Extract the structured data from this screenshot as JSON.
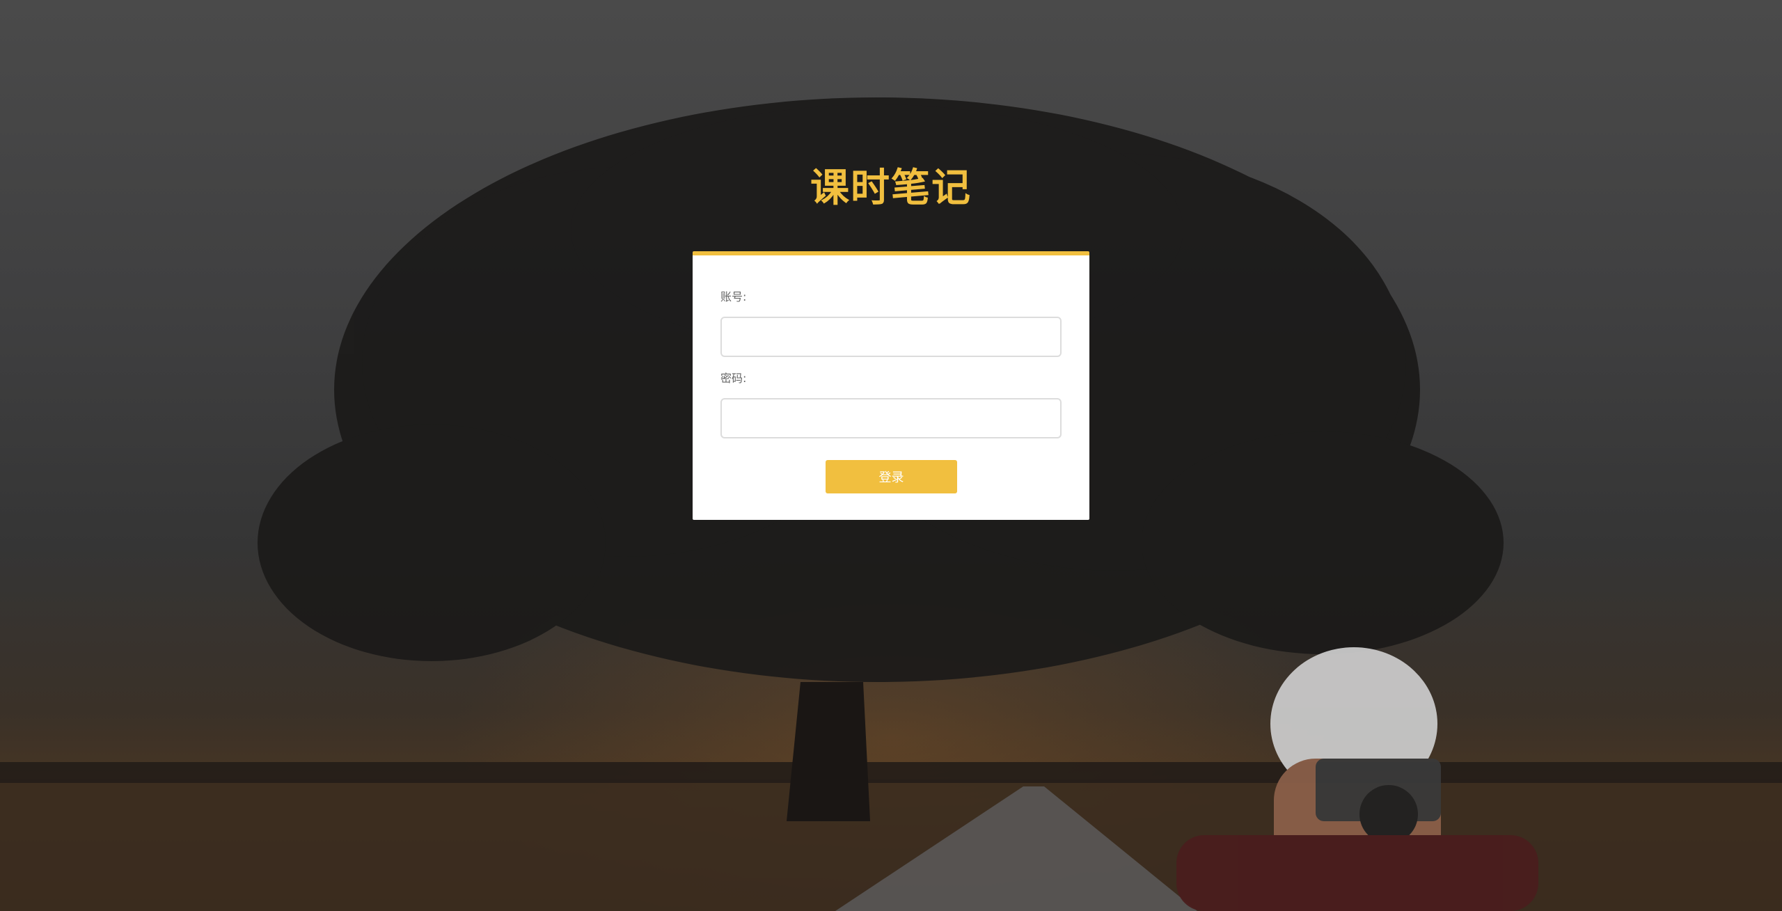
{
  "app": {
    "title": "课时笔记",
    "accent_color": "#f1bf3f"
  },
  "login_form": {
    "account_label": "账号:",
    "account_value": "",
    "account_placeholder": "",
    "password_label": "密码:",
    "password_value": "",
    "password_placeholder": "",
    "submit_label": "登录"
  },
  "background": {
    "description_icon": "landscape-photo-background"
  }
}
